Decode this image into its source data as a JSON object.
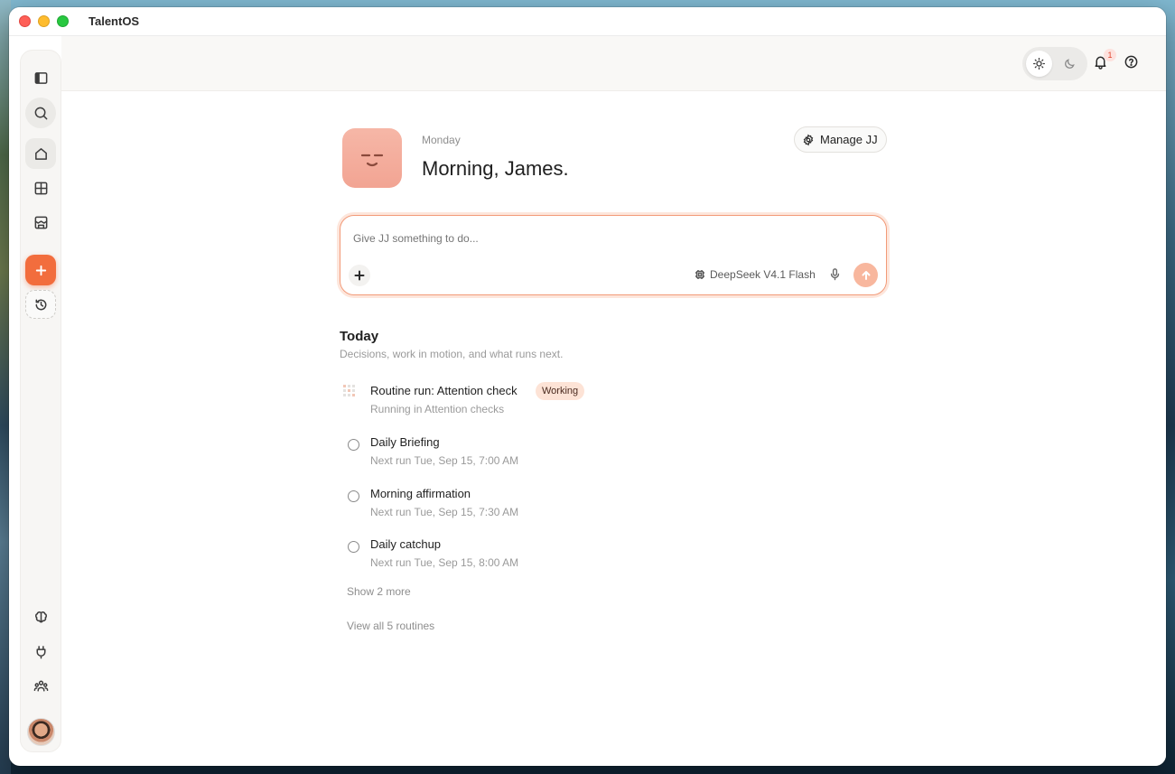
{
  "app": {
    "title": "TalentOS"
  },
  "topbar": {
    "notification_count": "1"
  },
  "header": {
    "day": "Monday",
    "greeting": "Morning, James.",
    "manage_label": "Manage JJ"
  },
  "composer": {
    "placeholder": "Give JJ something to do...",
    "model": "DeepSeek V4.1 Flash"
  },
  "today": {
    "title": "Today",
    "subtitle": "Decisions, work in motion, and what runs next.",
    "routines": [
      {
        "name": "Routine run: Attention check",
        "status": "Working",
        "detail": "Running in Attention checks"
      },
      {
        "name": "Daily Briefing",
        "detail": "Next run Tue, Sep 15, 7:00 AM"
      },
      {
        "name": "Morning affirmation",
        "detail": "Next run Tue, Sep 15, 7:30 AM"
      },
      {
        "name": "Daily catchup",
        "detail": "Next run Tue, Sep 15, 8:00 AM"
      }
    ],
    "show_more": "Show 2 more",
    "view_all": "View all 5 routines"
  },
  "colors": {
    "accent": "#f26d3d",
    "mascot": "#f4ad9c",
    "badge_bg": "#fde3d6"
  }
}
